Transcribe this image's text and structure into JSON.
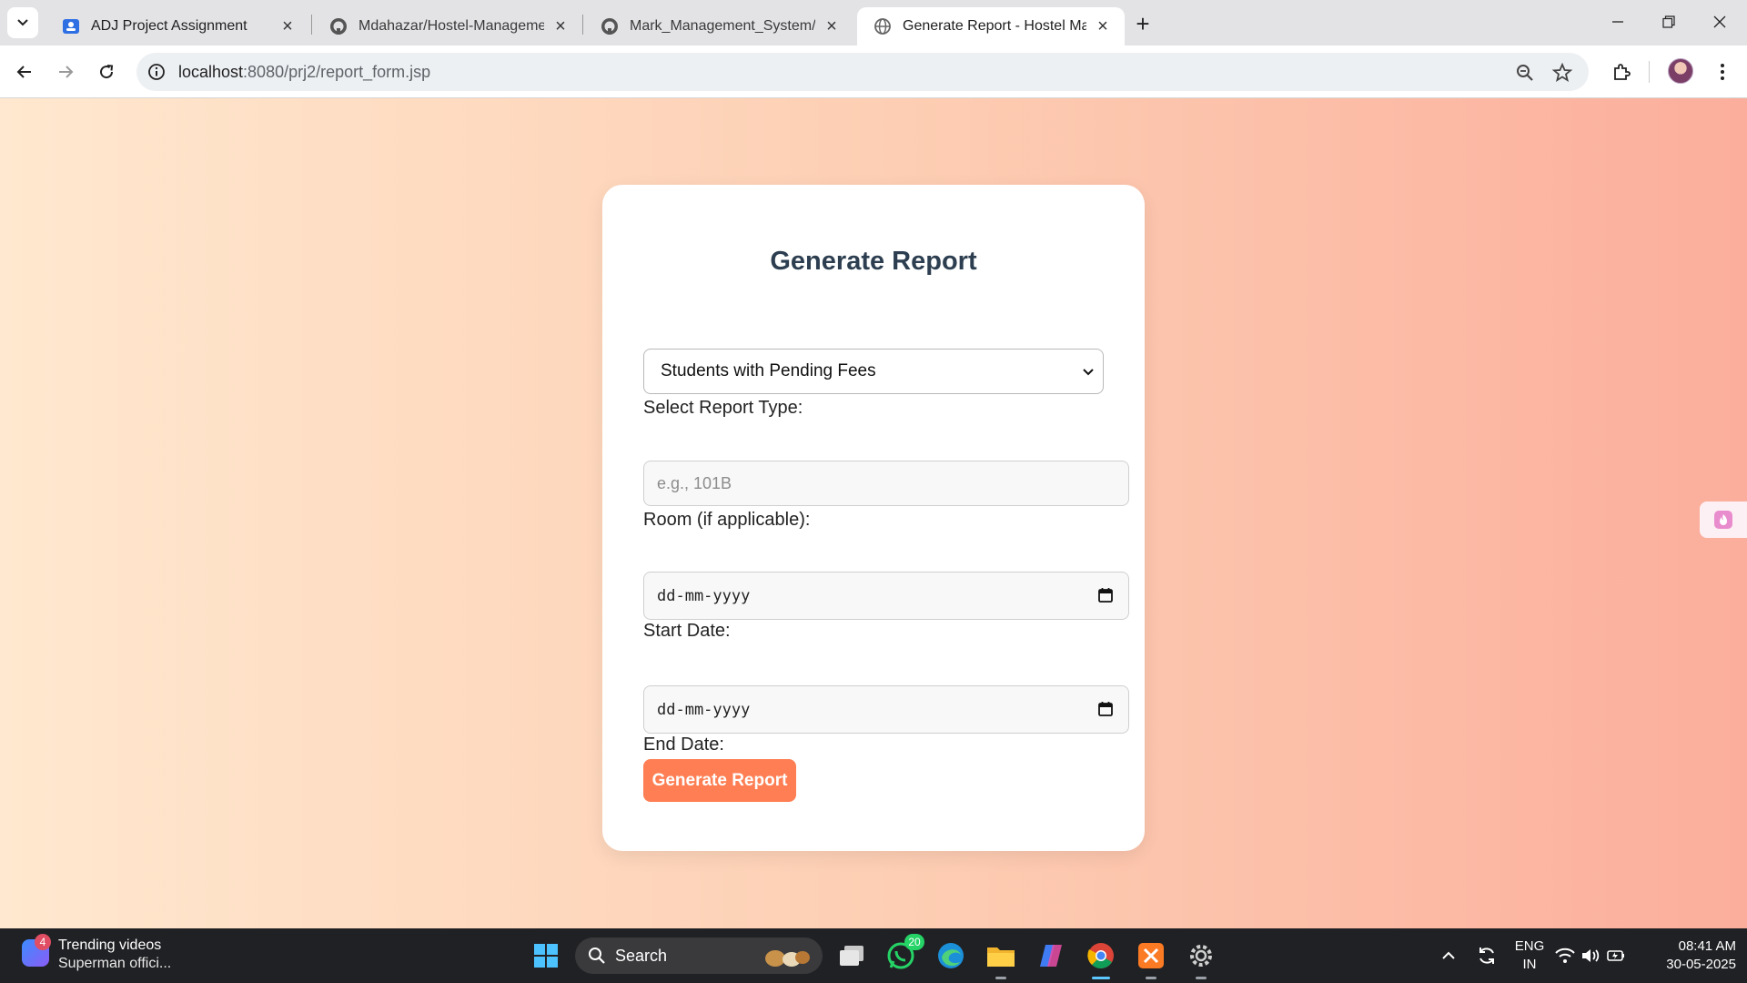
{
  "browser": {
    "tabs": [
      {
        "title": "ADJ Project Assignment",
        "icon": "person-card-icon"
      },
      {
        "title": "Mdahazar/Hostel-Management",
        "icon": "github-icon"
      },
      {
        "title": "Mark_Management_System/out",
        "icon": "github-icon"
      },
      {
        "title": "Generate Report - Hostel Mana",
        "icon": "globe-icon",
        "active": true
      }
    ],
    "url_host": "localhost",
    "url_path": ":8080/prj2/report_form.jsp"
  },
  "form": {
    "heading": "Generate Report",
    "report_type_label": "Select Report Type:",
    "report_type_value": "Students with Pending Fees",
    "room_label": "Room (if applicable):",
    "room_placeholder": "e.g., 101B",
    "start_date_label": "Start Date:",
    "start_date_value": "dd-mm-yyyy",
    "end_date_label": "End Date:",
    "end_date_value": "dd-mm-yyyy",
    "submit_label": "Generate Report"
  },
  "taskbar": {
    "widget_badge": "4",
    "widget_title": "Trending videos",
    "widget_sub": "Superman offici...",
    "search_label": "Search",
    "whatsapp_badge": "20",
    "lang_top": "ENG",
    "lang_bottom": "IN",
    "time": "08:41 AM",
    "date": "30-05-2025"
  },
  "colors": {
    "accent_button": "#ff7e53",
    "heading": "#2c3e50",
    "gradient_start": "#ffe8cf",
    "gradient_end": "#fbae9c"
  }
}
